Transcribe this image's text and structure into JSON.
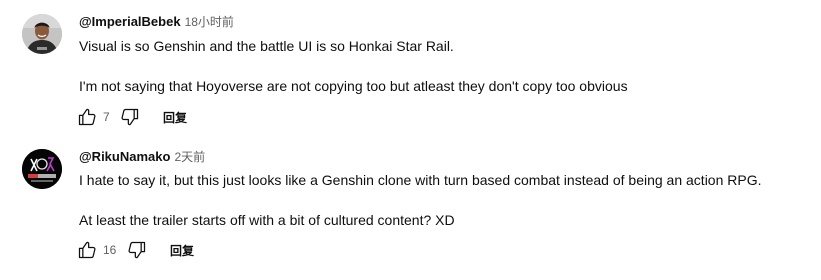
{
  "comments": [
    {
      "author": "@ImperialBebek",
      "time": "18小时前",
      "lines": [
        "Visual is so Genshin and the battle UI is so Honkai Star Rail.",
        "I'm not saying that Hoyoverse are not copying too but atleast they don't copy too obvious"
      ],
      "likes": "7",
      "reply_label": "回复",
      "avatar_icon": "person-photo-avatar"
    },
    {
      "author": "@RikuNamako",
      "time": "2天前",
      "lines": [
        "I hate to say it, but this just looks like a Genshin clone with turn based combat instead of being an action RPG.",
        "At least the trailer starts off with a bit of cultured content? XD"
      ],
      "likes": "16",
      "reply_label": "回复",
      "avatar_icon": "anime-logo-avatar"
    }
  ],
  "icons": {
    "like": "thumbs-up-icon",
    "dislike": "thumbs-down-icon"
  },
  "colors": {
    "text": "#0f0f0f",
    "secondary": "#606060",
    "background": "#ffffff"
  }
}
